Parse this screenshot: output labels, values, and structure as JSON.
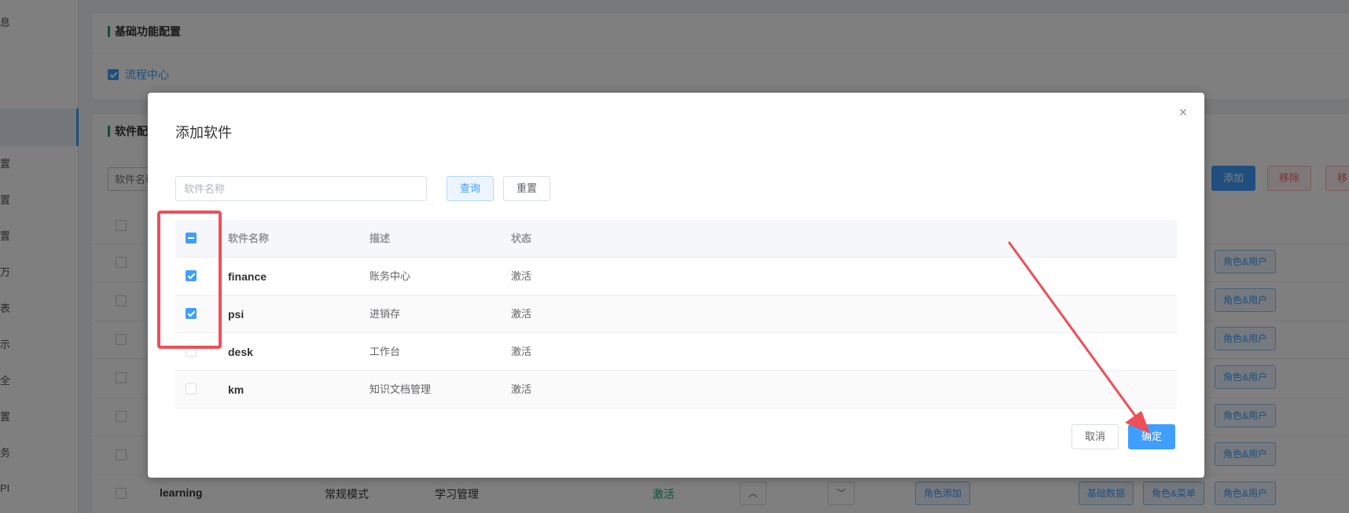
{
  "sidebar": {
    "items": [
      "息",
      "",
      "置",
      "置",
      "置",
      "万",
      "表",
      "示",
      "全",
      "置",
      "务",
      "PI"
    ]
  },
  "background": {
    "basic_section_title": "基础功能配置",
    "workflow_checkbox_label": "流程中心",
    "software_section_title": "软件配置",
    "search_placeholder": "软件名称",
    "add_button": "添加",
    "remove_button": "移除",
    "remove_button_2": "移",
    "role_user_label": "角色&用户",
    "last_row": {
      "name": "learning",
      "mode": "常规模式",
      "desc": "学习管理",
      "status": "激活",
      "up_arrow": "︿",
      "down_arrow": "﹀",
      "role_add": "角色添加",
      "base_data": "基础数据",
      "role_menu": "角色&菜单",
      "role_user": "角色&用户"
    }
  },
  "dialog": {
    "title": "添加软件",
    "close_icon": "×",
    "search_placeholder": "软件名称",
    "query_button": "查询",
    "reset_button": "重置",
    "columns": [
      "软件名称",
      "描述",
      "状态"
    ],
    "rows": [
      {
        "name": "finance",
        "desc": "账务中心",
        "status": "激活",
        "checked": true
      },
      {
        "name": "psi",
        "desc": "进销存",
        "status": "激活",
        "checked": true
      },
      {
        "name": "desk",
        "desc": "工作台",
        "status": "激活",
        "checked": false
      },
      {
        "name": "km",
        "desc": "知识文档管理",
        "status": "激活",
        "checked": false
      }
    ],
    "cancel_button": "取消",
    "confirm_button": "确定"
  },
  "colors": {
    "primary": "#409eff",
    "annotation_red": "#f04e57",
    "active_green": "#1aa06d"
  }
}
